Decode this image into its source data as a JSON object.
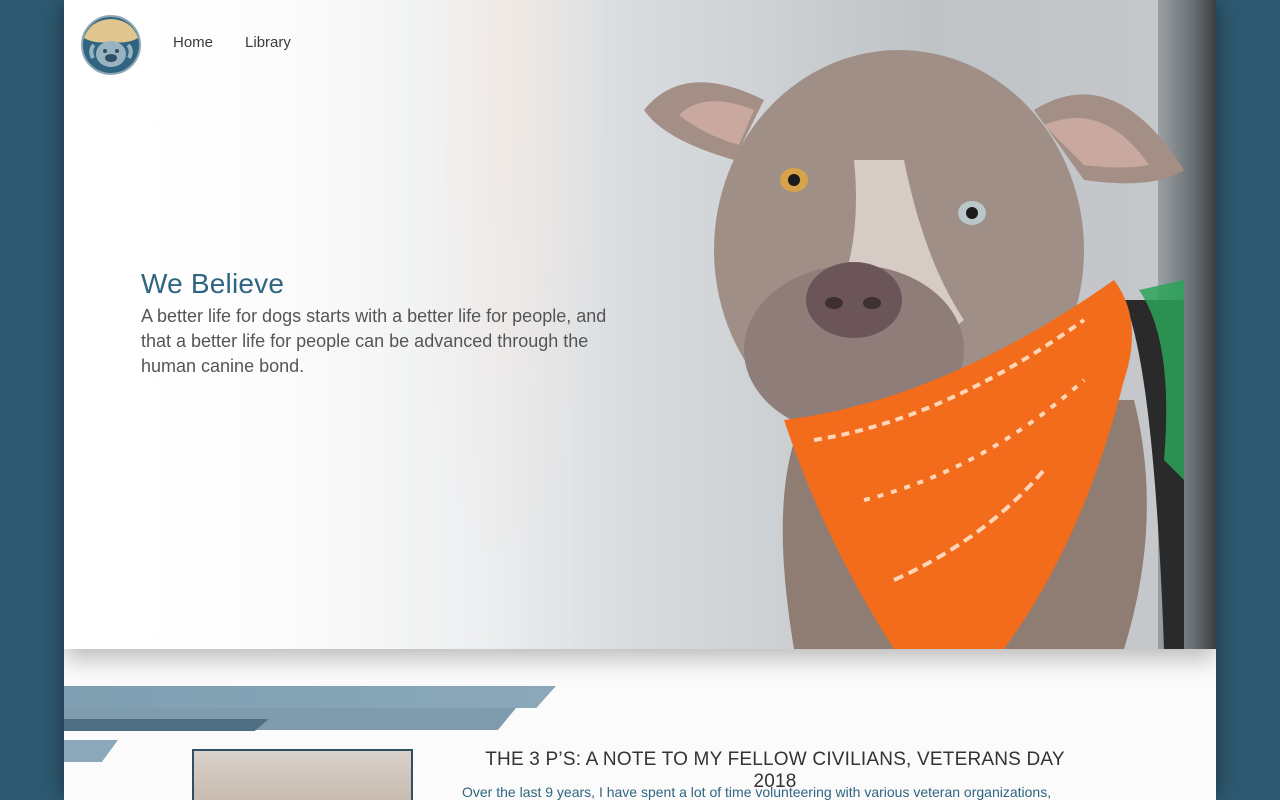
{
  "nav": {
    "items": [
      {
        "label": "Home"
      },
      {
        "label": "Library"
      }
    ]
  },
  "hero": {
    "heading": "We Believe",
    "body": "A better life for dogs starts with a better life for people, and that a better life for people can be advanced through the human canine bond."
  },
  "post": {
    "title": "THE 3 P’S: A NOTE TO MY FELLOW CIVILIANS, VETERANS DAY 2018",
    "excerpt": "Over the last 9 years, I have spent a lot of time volunteering with various veteran organizations,"
  },
  "colors": {
    "accent": "#2f6580",
    "background": "#2f5a72",
    "bandana": "#f26c1b"
  },
  "icons": {
    "logo": "dog-logo-icon"
  }
}
